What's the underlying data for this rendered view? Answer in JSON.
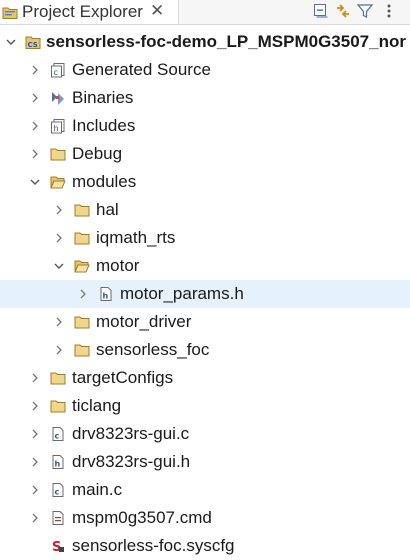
{
  "panel": {
    "title": "Project Explorer",
    "close_glyph": "✕"
  },
  "toolbar": [
    {
      "name": "collapse-all-icon"
    },
    {
      "name": "link-with-editor-icon"
    },
    {
      "name": "filter-icon"
    },
    {
      "name": "view-menu-icon"
    }
  ],
  "tree": [
    {
      "label": "sensorless-foc-demo_LP_MSPM0G3507_nor",
      "icon": "project-icon",
      "state": "expanded",
      "bold": true
    },
    {
      "label": "Generated Source",
      "icon": "generated-source-icon",
      "state": "collapsed"
    },
    {
      "label": "Binaries",
      "icon": "binaries-icon",
      "state": "collapsed"
    },
    {
      "label": "Includes",
      "icon": "includes-icon",
      "state": "collapsed"
    },
    {
      "label": "Debug",
      "icon": "folder-icon",
      "state": "collapsed"
    },
    {
      "label": "modules",
      "icon": "folder-icon",
      "state": "expanded"
    },
    {
      "label": "hal",
      "icon": "folder-icon",
      "state": "collapsed"
    },
    {
      "label": "iqmath_rts",
      "icon": "folder-icon",
      "state": "collapsed"
    },
    {
      "label": "motor",
      "icon": "folder-icon",
      "state": "expanded"
    },
    {
      "label": "motor_params.h",
      "icon": "header-file-icon",
      "state": "collapsed",
      "selected": true
    },
    {
      "label": "motor_driver",
      "icon": "folder-icon",
      "state": "collapsed"
    },
    {
      "label": "sensorless_foc",
      "icon": "folder-icon",
      "state": "collapsed"
    },
    {
      "label": "targetConfigs",
      "icon": "folder-icon",
      "state": "collapsed"
    },
    {
      "label": "ticlang",
      "icon": "folder-icon",
      "state": "collapsed"
    },
    {
      "label": "drv8323rs-gui.c",
      "icon": "c-file-icon",
      "state": "collapsed"
    },
    {
      "label": "drv8323rs-gui.h",
      "icon": "header-file-icon",
      "state": "collapsed"
    },
    {
      "label": "main.c",
      "icon": "c-file-icon",
      "state": "collapsed"
    },
    {
      "label": "mspm0g3507.cmd",
      "icon": "cmd-file-icon",
      "state": "collapsed"
    },
    {
      "label": "sensorless-foc.syscfg",
      "icon": "syscfg-file-icon",
      "state": "none"
    }
  ]
}
